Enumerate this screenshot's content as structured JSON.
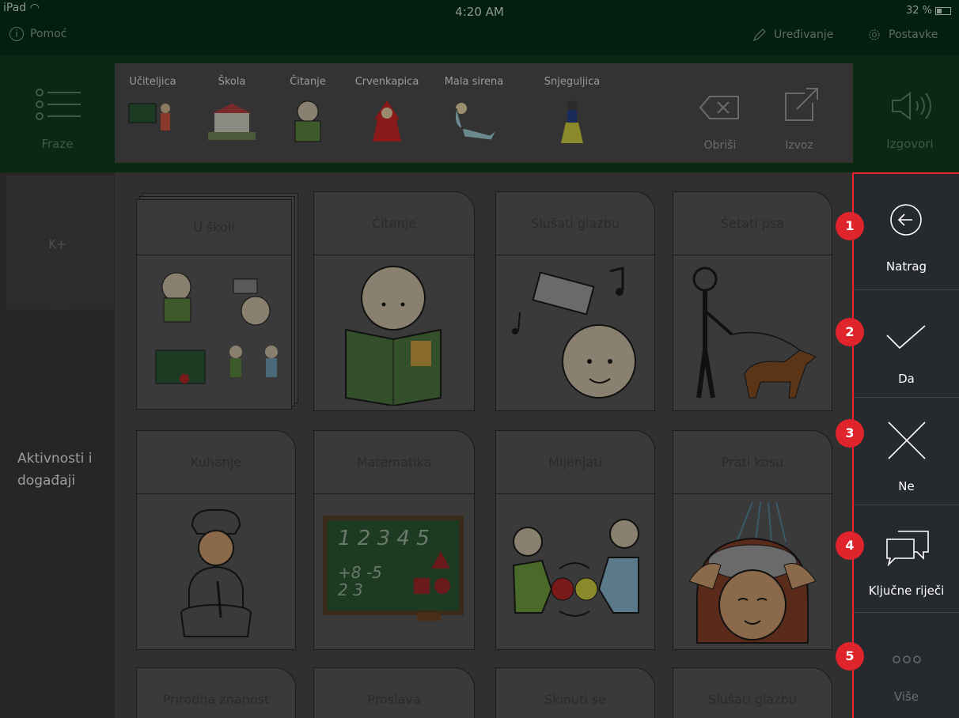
{
  "status_bar": {
    "device": "iPad",
    "time": "4:20 AM",
    "battery": "32 %"
  },
  "toolbar": {
    "help": "Pomoć",
    "edit": "Uređivanje",
    "settings": "Postavke"
  },
  "phrases_label": "Fraze",
  "sentence_words": [
    "Učiteljica",
    "Škola",
    "Čitanje",
    "Crvenkapica",
    "Mala sirena",
    "Snjeguljica"
  ],
  "sentence_actions": {
    "delete": "Obriši",
    "export": "Izvoz"
  },
  "speak_label": "Izgovori",
  "left_panel": {
    "add_label": "K+",
    "category": "Aktivnosti i događaji"
  },
  "cards": [
    {
      "title": "U školi",
      "icon": "school-collage"
    },
    {
      "title": "Čitanje",
      "icon": "reading-child"
    },
    {
      "title": "Slušati glazbu",
      "icon": "radio-music"
    },
    {
      "title": "Šetati psa",
      "icon": "walking-dog"
    },
    {
      "title": "Kuhanje",
      "icon": "chef-cooking"
    },
    {
      "title": "Matematika",
      "icon": "chalkboard-math"
    },
    {
      "title": "Mijenjati",
      "icon": "exchange"
    },
    {
      "title": "Prati kosu",
      "icon": "washing-hair"
    },
    {
      "title": "Prirodna znanost",
      "icon": ""
    },
    {
      "title": "Proslava",
      "icon": ""
    },
    {
      "title": "Skinuti se",
      "icon": ""
    },
    {
      "title": "Slušati glazbu",
      "icon": ""
    }
  ],
  "right_menu": [
    {
      "badge": "1",
      "label": "Natrag",
      "icon": "back-arrow-icon"
    },
    {
      "badge": "2",
      "label": "Da",
      "icon": "check-icon"
    },
    {
      "badge": "3",
      "label": "Ne",
      "icon": "cross-icon"
    },
    {
      "badge": "4",
      "label": "Ključne riječi",
      "icon": "chat-bubbles-icon"
    },
    {
      "badge": "5",
      "label": "Više",
      "icon": "more-dots-icon"
    }
  ],
  "colors": {
    "highlight": "#e8242d",
    "badge": "#e0242c",
    "header_green": "#0b2813"
  }
}
